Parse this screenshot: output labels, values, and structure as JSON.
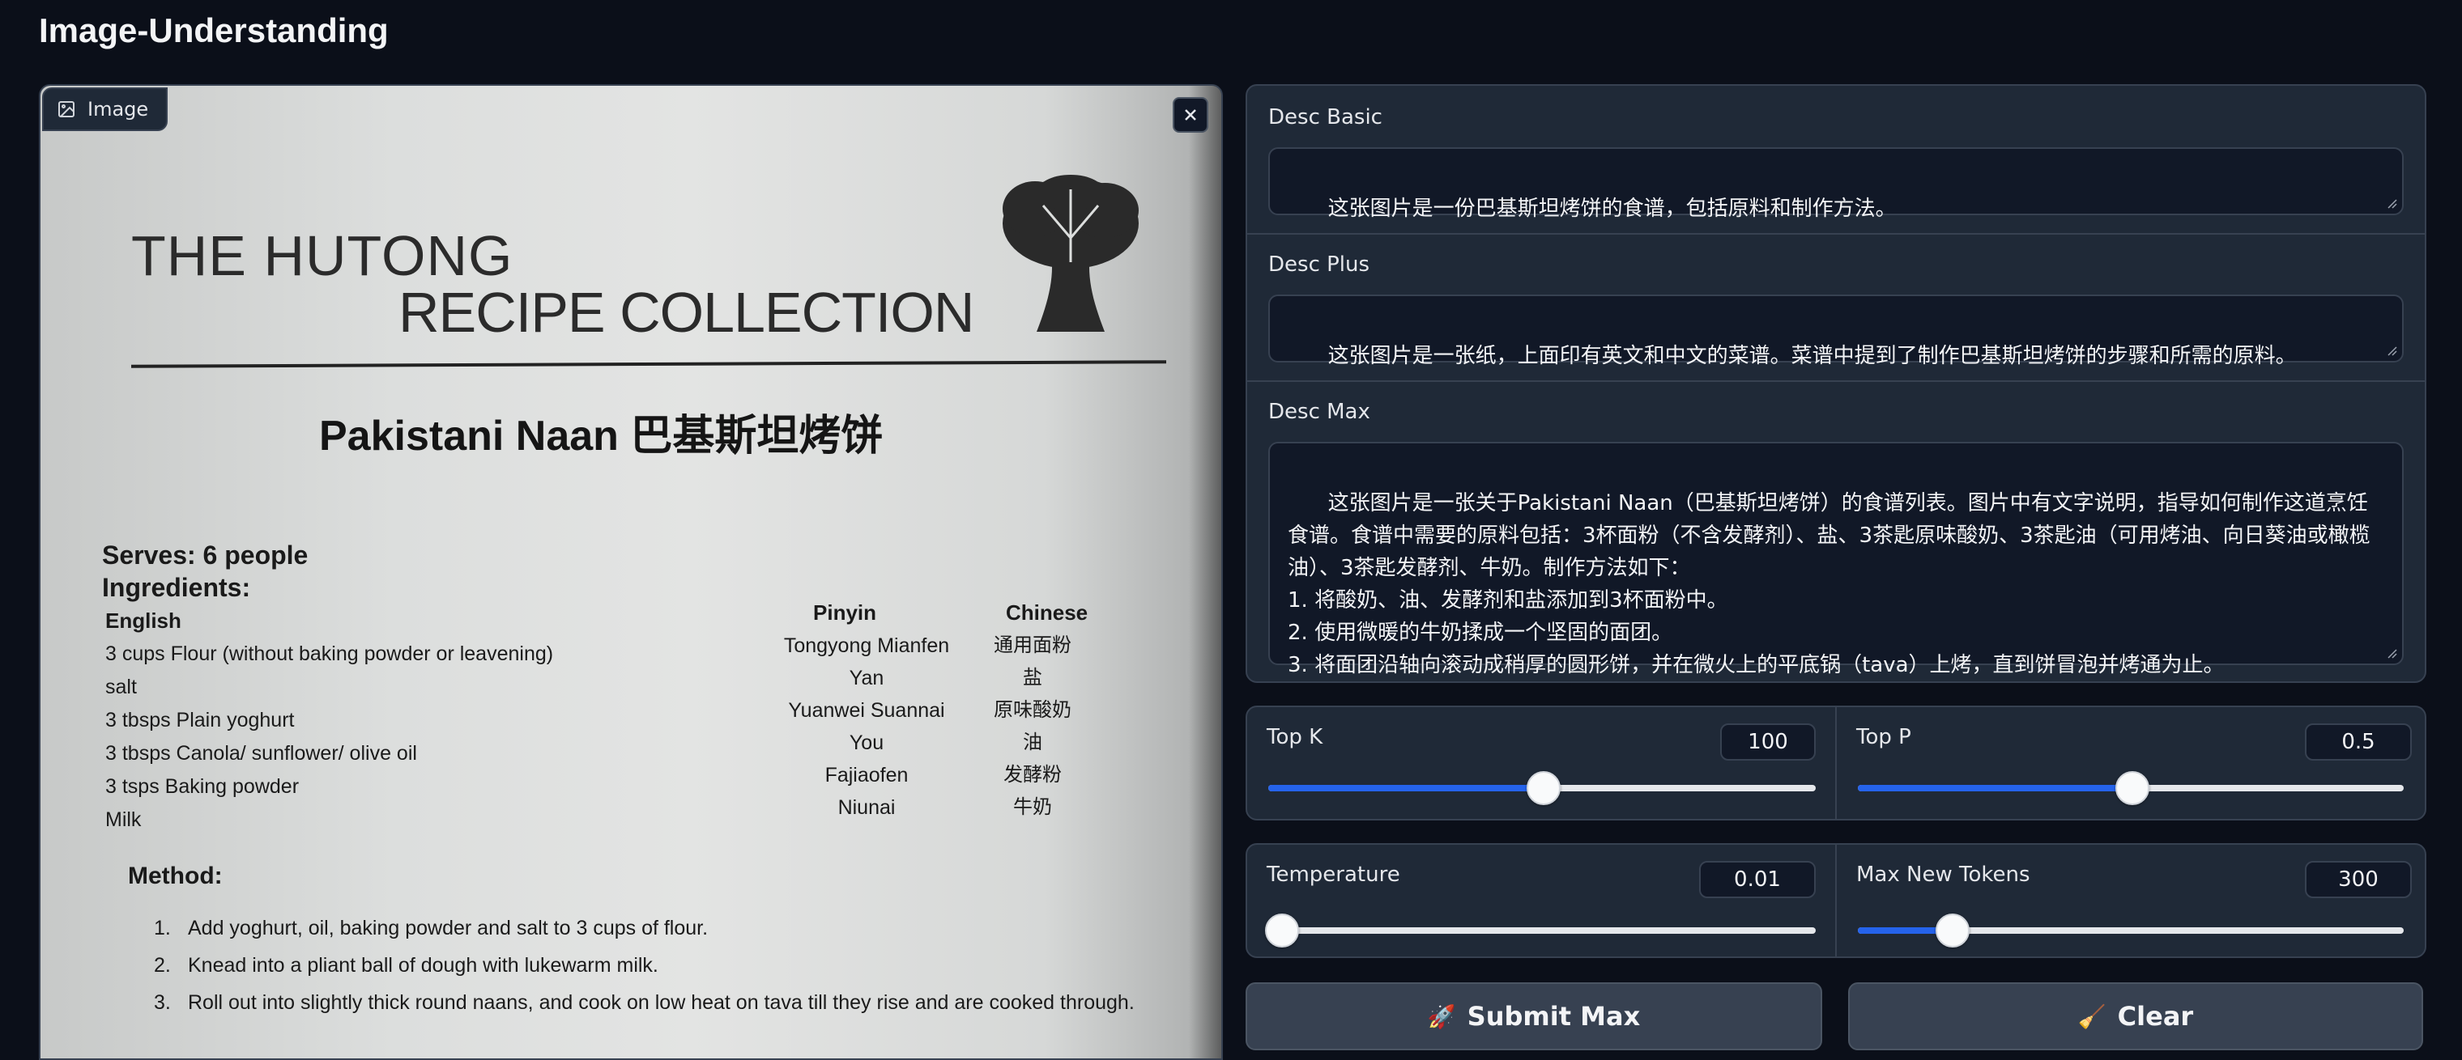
{
  "app": {
    "title": "Image-Understanding"
  },
  "image_panel": {
    "label": "Image",
    "paper": {
      "brand_line1": "THE HUTONG",
      "brand_line2": "RECIPE COLLECTION",
      "recipe_title": "Pakistani Naan 巴基斯坦烤饼",
      "serves": "Serves: 6 people",
      "ingredients_heading": "Ingredients:",
      "col_english": "English",
      "col_pinyin": "Pinyin",
      "col_chinese": "Chinese",
      "english_items": [
        "3 cups  Flour (without baking powder or leavening)",
        "salt",
        "3 tbsps Plain yoghurt",
        "3 tbsps Canola/ sunflower/ olive oil",
        "3 tsps   Baking powder",
        "Milk"
      ],
      "pinyin_items": [
        "Tongyong Mianfen",
        "Yan",
        "Yuanwei Suannai",
        "You",
        "Fajiaofen",
        "Niunai"
      ],
      "chinese_items": [
        "通用面粉",
        "盐",
        "原味酸奶",
        "油",
        "发酵粉",
        "牛奶"
      ],
      "method_heading": "Method:",
      "steps": [
        {
          "num": "1.",
          "text": "Add yoghurt, oil, baking powder and salt to 3 cups of flour."
        },
        {
          "num": "2.",
          "text": "Knead into a pliant ball of dough with lukewarm milk."
        },
        {
          "num": "3.",
          "text": "Roll out into slightly thick round naans, and cook on low heat on tava till they rise and are cooked through."
        }
      ]
    }
  },
  "desc": {
    "basic": {
      "label": "Desc Basic",
      "value": "这张图片是一份巴基斯坦烤饼的食谱，包括原料和制作方法。"
    },
    "plus": {
      "label": "Desc Plus",
      "value": "这张图片是一张纸，上面印有英文和中文的菜谱。菜谱中提到了制作巴基斯坦烤饼的步骤和所需的原料。"
    },
    "max": {
      "label": "Desc Max",
      "value": "这张图片是一张关于Pakistani Naan（巴基斯坦烤饼）的食谱列表。图片中有文字说明，指导如何制作这道烹饪食谱。食谱中需要的原料包括：3杯面粉（不含发酵剂）、盐、3茶匙原味酸奶、3茶匙油（可用烤油、向日葵油或橄榄油）、3茶匙发酵剂、牛奶。制作方法如下：\n1. 将酸奶、油、发酵剂和盐添加到3杯面粉中。\n2. 使用微暖的牛奶揉成一个坚固的面团。\n3. 将面团沿轴向滚动成稍厚的圆形饼，并在微火上的平底锅（tava）上烤，直到饼冒泡并烤通为止。"
    }
  },
  "sliders": {
    "top_k": {
      "label": "Top K",
      "value": "100",
      "fraction": 0.5
    },
    "top_p": {
      "label": "Top P",
      "value": "0.5",
      "fraction": 0.5
    },
    "temperature": {
      "label": "Temperature",
      "value": "0.01",
      "fraction": 0.0
    },
    "max_new_tokens": {
      "label": "Max New Tokens",
      "value": "300",
      "fraction": 0.17
    }
  },
  "buttons": {
    "submit": {
      "icon": "🚀",
      "label": "Submit Max"
    },
    "clear": {
      "icon": "🧹",
      "label": "Clear"
    }
  },
  "colors": {
    "accent": "#2563eb",
    "panel": "#1f2937",
    "background": "#0b0f19"
  }
}
